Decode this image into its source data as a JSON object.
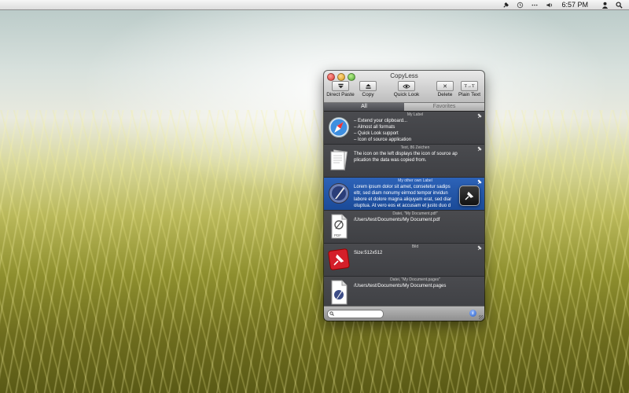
{
  "menubar": {
    "time": "6:57 PM"
  },
  "window": {
    "title": "CopyLess",
    "toolbar": [
      {
        "label": "Direct Paste",
        "icon": "direct-paste-icon"
      },
      {
        "label": "Copy",
        "icon": "copy-icon"
      },
      {
        "label": "Quick Look",
        "icon": "quick-look-icon"
      },
      {
        "label": "Delete",
        "icon": "delete-icon"
      },
      {
        "label": "Plain Text",
        "icon": "plain-text-icon"
      }
    ],
    "tabs": [
      {
        "label": "All",
        "selected": true
      },
      {
        "label": "Favorites",
        "selected": false
      }
    ],
    "items": [
      {
        "label": "My Label",
        "text": "– Extend your clipboard...\n– Almost all formats\n– Quick Look support\n– Icon of source application",
        "icon": "safari-icon",
        "pinned": true
      },
      {
        "label": "Text, 86 Zeichen",
        "text": "The icon on the left displays the icon of source ap\nplication the data was copied from.",
        "icon": "text-document-icon",
        "pinned": true
      },
      {
        "label": "My other own Label",
        "text": "Lorem ipsum dolor sit amet, consetetur sadips\neltr, sed diam nonumy eirmod tempor invidun\nlabore et dolore magna aliquyam erat, sed diar\noluptua. At vero eos et accusam et justo duo d",
        "icon": "quill-app-icon",
        "pinned": true,
        "selected": true
      },
      {
        "label": "Datei, \"My Document.pdf\"",
        "text": "/Users/test/Documents/My Document.pdf",
        "icon": "pdf-file-icon",
        "icon_caption": "PDF",
        "pinned": false
      },
      {
        "label": "Bild",
        "text": "Size:512x512",
        "icon": "image-pin-icon",
        "pinned": true
      },
      {
        "label": "Datei, \"My Document.pages\"",
        "text": "/Users/test/Documents/My Document.pages",
        "icon": "pages-file-icon",
        "pinned": false
      }
    ],
    "search": {
      "placeholder": ""
    }
  }
}
